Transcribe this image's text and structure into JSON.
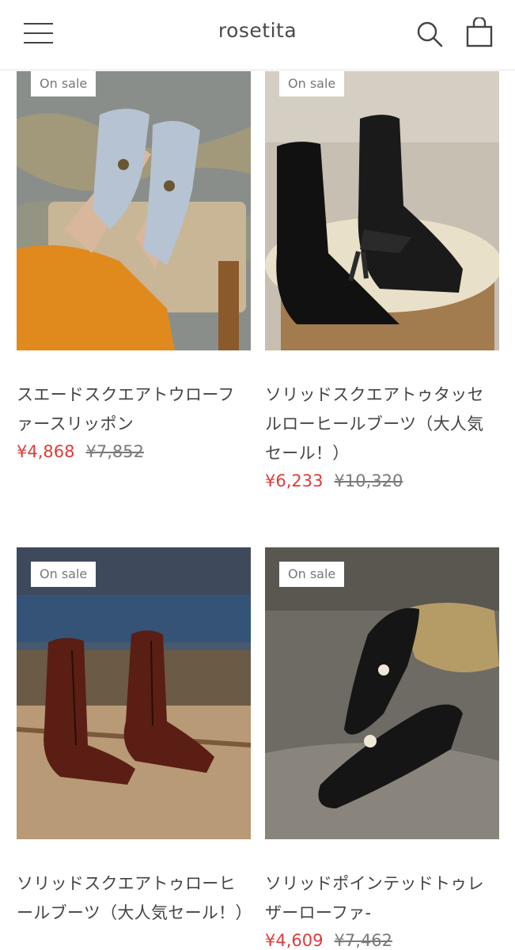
{
  "header": {
    "logo": "rosetita"
  },
  "products": [
    {
      "badge": "On sale",
      "title": "スエードスクエアトウローファースリッポン",
      "sale_price": "¥4,868",
      "original_price": "¥7,852"
    },
    {
      "badge": "On sale",
      "title": "ソリッドスクエアトゥタッセルローヒールブーツ（大人気セール！）",
      "sale_price": "¥6,233",
      "original_price": "¥10,320"
    },
    {
      "badge": "On sale",
      "title": "ソリッドスクエアトゥローヒールブーツ（大人気セール！）",
      "sale_price": "",
      "original_price": ""
    },
    {
      "badge": "On sale",
      "title": "ソリッドポインテッドトゥレザーローファ-",
      "sale_price": "¥4,609",
      "original_price": "¥7,462"
    }
  ],
  "colors": {
    "sale_price": "#e03a3a",
    "text": "#444444"
  },
  "icons": [
    "menu-icon",
    "search-icon",
    "cart-icon"
  ]
}
